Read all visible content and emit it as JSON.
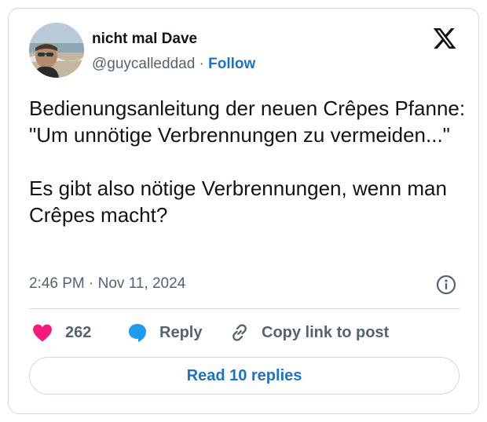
{
  "tweet": {
    "author_name": "nicht mal Dave",
    "author_handle": "@guycalleddad",
    "separator": "·",
    "follow_label": "Follow",
    "text": "Bedienungsanleitung der neuen Crêpes Pfanne: \"Um unnötige Verbrennungen zu vermeiden...\"\n\nEs gibt also nötige Verbrennungen, wenn man Crêpes macht?",
    "timestamp": "2:46 PM · Nov 11, 2024"
  },
  "actions": {
    "like_count": "262",
    "reply_label": "Reply",
    "copy_link_label": "Copy link to post"
  },
  "read_replies_label": "Read 10 replies",
  "icons": {
    "brand": "x-logo-icon",
    "info": "info-icon",
    "like": "heart-icon",
    "reply": "speech-bubble-icon",
    "copy": "link-icon"
  },
  "colors": {
    "accent": "#1d72c9",
    "like": "#f91880",
    "reply_icon": "#1d9bf0",
    "muted_text": "#536471",
    "border": "#cfd9de"
  }
}
